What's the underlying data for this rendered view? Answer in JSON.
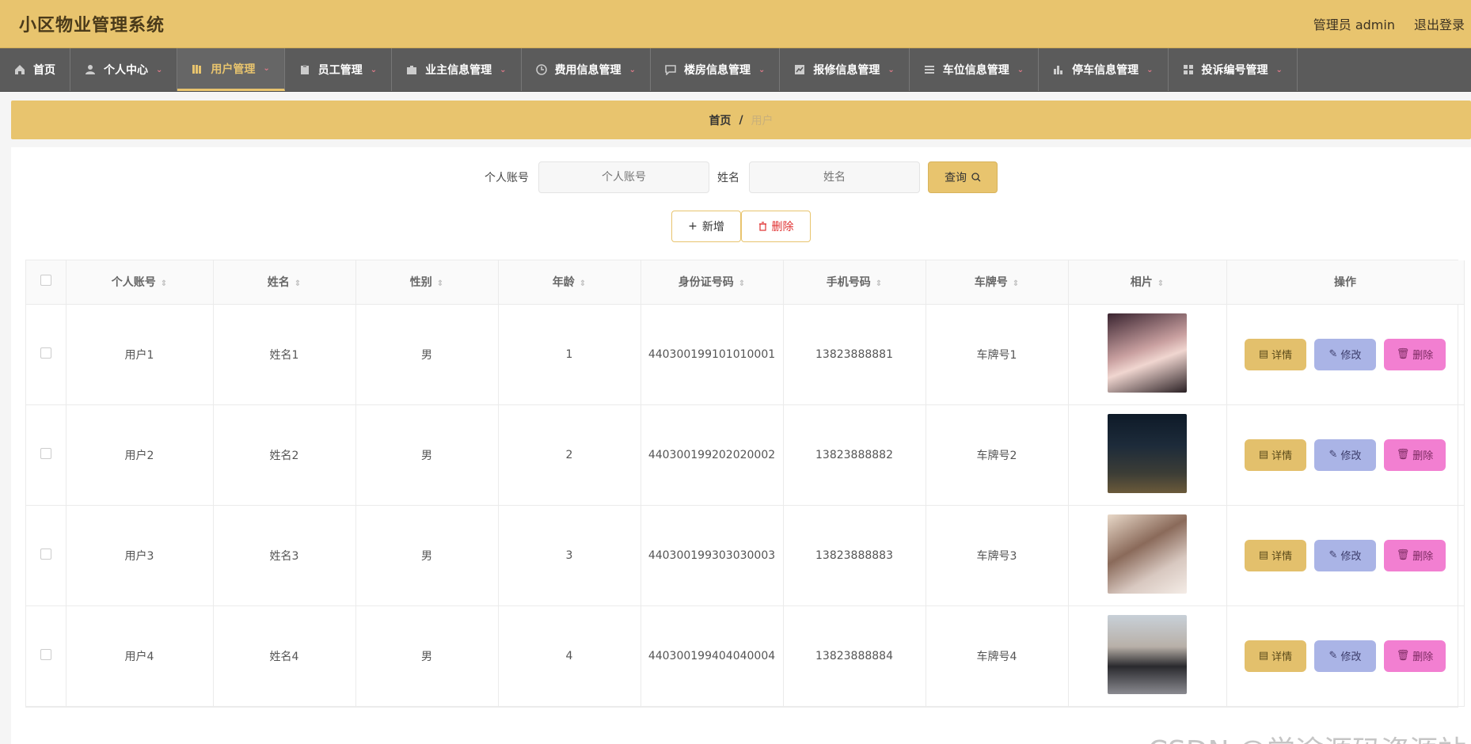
{
  "app": {
    "title": "小区物业管理系统",
    "user": "管理员 admin",
    "logout": "退出登录"
  },
  "nav": [
    {
      "label": "首页",
      "icon": "home-icon"
    },
    {
      "label": "个人中心",
      "icon": "user-icon"
    },
    {
      "label": "用户管理",
      "icon": "library-icon"
    },
    {
      "label": "员工管理",
      "icon": "clipboard-icon"
    },
    {
      "label": "业主信息管理",
      "icon": "briefcase-icon"
    },
    {
      "label": "费用信息管理",
      "icon": "clock-icon"
    },
    {
      "label": "楼房信息管理",
      "icon": "chat-icon"
    },
    {
      "label": "报修信息管理",
      "icon": "chart-icon"
    },
    {
      "label": "车位信息管理",
      "icon": "list-icon"
    },
    {
      "label": "停车信息管理",
      "icon": "bar-icon"
    },
    {
      "label": "投诉编号管理",
      "icon": "grid-icon"
    }
  ],
  "breadcrumb": {
    "home": "首页",
    "sep": "/",
    "current": "用户"
  },
  "search": {
    "account_label": "个人账号",
    "account_placeholder": "个人账号",
    "name_label": "姓名",
    "name_placeholder": "姓名",
    "query": "查询"
  },
  "actions": {
    "add": "新增",
    "delete": "删除"
  },
  "table": {
    "headers": [
      "个人账号",
      "姓名",
      "性别",
      "年龄",
      "身份证号码",
      "手机号码",
      "车牌号",
      "相片",
      "操作"
    ],
    "rows": [
      {
        "account": "用户1",
        "name": "姓名1",
        "gender": "男",
        "age": "1",
        "id": "440300199101010001",
        "phone": "13823888881",
        "plate": "车牌号1"
      },
      {
        "account": "用户2",
        "name": "姓名2",
        "gender": "男",
        "age": "2",
        "id": "440300199202020002",
        "phone": "13823888882",
        "plate": "车牌号2"
      },
      {
        "account": "用户3",
        "name": "姓名3",
        "gender": "男",
        "age": "3",
        "id": "440300199303030003",
        "phone": "13823888883",
        "plate": "车牌号3"
      },
      {
        "account": "用户4",
        "name": "姓名4",
        "gender": "男",
        "age": "4",
        "id": "440300199404040004",
        "phone": "13823888884",
        "plate": "车牌号4"
      }
    ],
    "ops": {
      "detail": "详情",
      "edit": "修改",
      "delete": "删除"
    }
  },
  "watermark": "CSDN @学途源码资源站",
  "colors": {
    "accent": "#e8c46e",
    "nav_bg": "#5b5b5b",
    "detail": "#e3c06c",
    "edit": "#aab4e6",
    "delete": "#f27fd1"
  }
}
